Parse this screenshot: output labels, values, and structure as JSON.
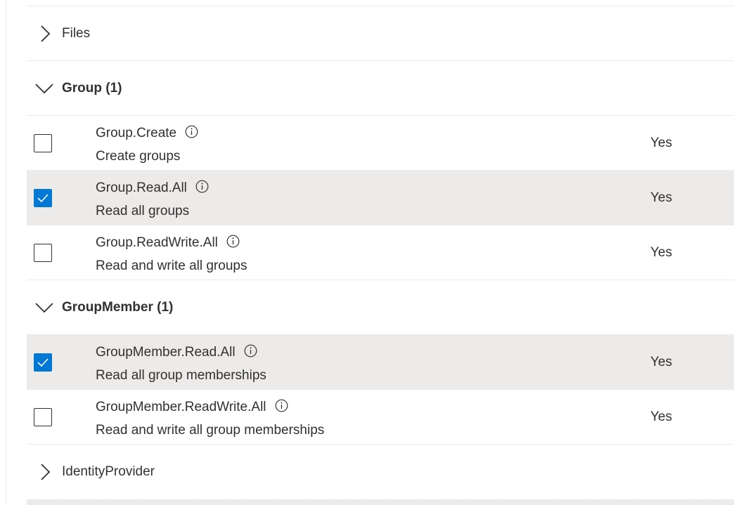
{
  "sections": {
    "files": {
      "label": "Files",
      "expanded": false
    },
    "group": {
      "label": "Group (1)",
      "expanded": true,
      "permissions": [
        {
          "name": "Group.Create",
          "description": "Create groups",
          "admin_consent": "Yes",
          "checked": false
        },
        {
          "name": "Group.Read.All",
          "description": "Read all groups",
          "admin_consent": "Yes",
          "checked": true
        },
        {
          "name": "Group.ReadWrite.All",
          "description": "Read and write all groups",
          "admin_consent": "Yes",
          "checked": false
        }
      ]
    },
    "groupmember": {
      "label": "GroupMember (1)",
      "expanded": true,
      "permissions": [
        {
          "name": "GroupMember.Read.All",
          "description": "Read all group memberships",
          "admin_consent": "Yes",
          "checked": true
        },
        {
          "name": "GroupMember.ReadWrite.All",
          "description": "Read and write all group memberships",
          "admin_consent": "Yes",
          "checked": false
        }
      ]
    },
    "identityprovider": {
      "label": "IdentityProvider",
      "expanded": false
    }
  },
  "icons": {
    "collapsed_chevron": "chevron-right-icon",
    "expanded_chevron": "chevron-down-icon",
    "info": "info-icon",
    "checkmark": "checkmark-icon"
  },
  "colors": {
    "accent": "#0078d4",
    "selected_row": "#edebe9",
    "divider": "#edebe9",
    "text": "#323130"
  }
}
